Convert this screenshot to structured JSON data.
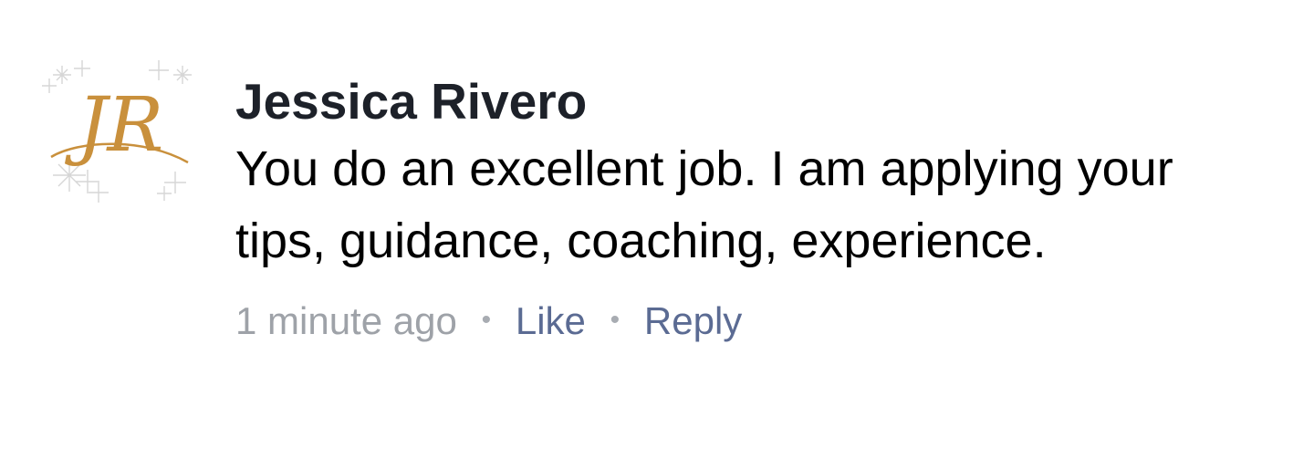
{
  "comment": {
    "avatar_monogram": "JR",
    "avatar_color": "#c9903c",
    "author": "Jessica Rivero",
    "text": "You do an excellent job. I am applying your tips, guidance, coaching, experience.",
    "timestamp": "1 minute ago",
    "separator": "•",
    "like_label": "Like",
    "reply_label": "Reply",
    "author_color": "#1d2129",
    "link_color": "#5b6b93",
    "meta_color": "#9ea2a8"
  }
}
